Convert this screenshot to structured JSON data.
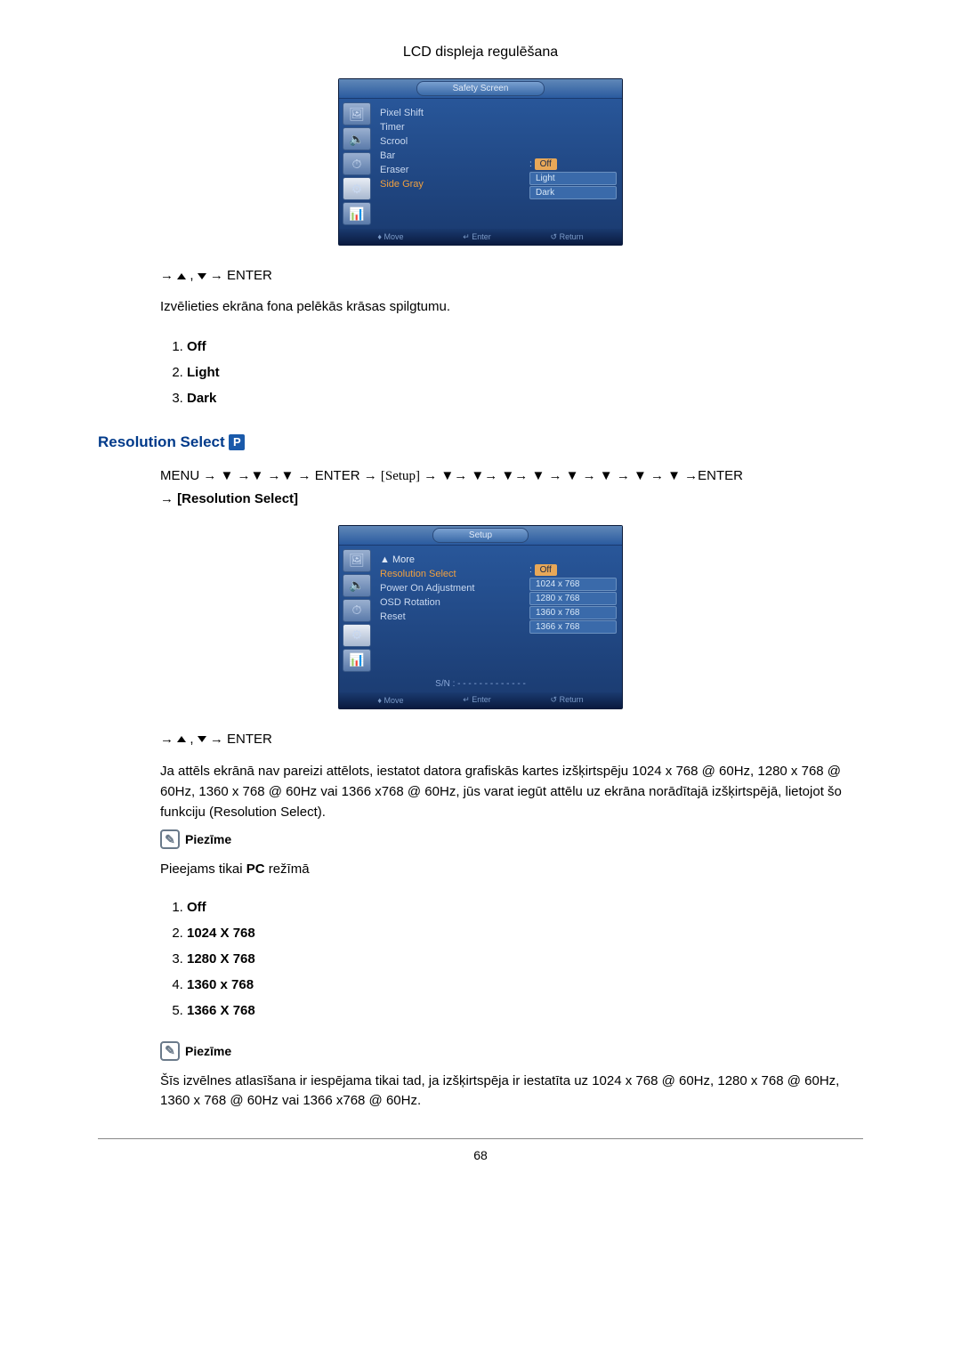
{
  "header": {
    "title": "LCD displeja regulēšana"
  },
  "osd1": {
    "title": "Safety Screen",
    "items": [
      "Pixel Shift",
      "Timer",
      "Scrool",
      "Bar",
      "Eraser",
      "Side Gray"
    ],
    "sel_idx": 5,
    "values": [
      "Off",
      "Light",
      "Dark"
    ],
    "val_sel_idx": 0,
    "bottom": {
      "move": "Move",
      "enter": "Enter",
      "return": "Return"
    }
  },
  "nav1": "→ ▲ , ▼ → ENTER",
  "desc1": "Izvēlieties ekrāna fona pelēkās krāsas spilgtumu.",
  "opts1": [
    "Off",
    "Light",
    "Dark"
  ],
  "section2": {
    "title": "Resolution Select"
  },
  "nav2a_prefix": "MENU → ▼ →▼ →▼ → ENTER → ",
  "nav2a_setup": "[Setup]",
  "nav2a_mid": " → ▼→ ▼→ ▼→ ▼ → ▼ → ▼ → ▼ → ▼ →ENTER",
  "nav2b": "→ ",
  "nav2b_bold": "[Resolution Select]",
  "osd2": {
    "title": "Setup",
    "more": "▲ More",
    "items": [
      "Resolution Select",
      "Power On Adjustment",
      "OSD Rotation",
      "Reset"
    ],
    "sel_idx": 0,
    "values": [
      "Off",
      "1024 x 768",
      "1280 x 768",
      "1360 x 768",
      "1366 x 768"
    ],
    "val_sel_idx": 0,
    "sn": "S/N : - - - - - - - - - - - - -",
    "bottom": {
      "move": "Move",
      "enter": "Enter",
      "return": "Return"
    }
  },
  "nav3": "→ ▲ , ▼ → ENTER",
  "desc2": "Ja attēls ekrānā nav pareizi attēlots, iestatot datora grafiskās kartes izšķirtspēju 1024 x 768 @ 60Hz, 1280 x 768 @ 60Hz, 1360 x 768 @ 60Hz vai 1366 x768 @ 60Hz, jūs varat iegūt attēlu uz ekrāna norādītajā izšķirtspējā, lietojot šo funkciju (Resolution Select).",
  "note1_label": "Piezīme",
  "note1_text_a": "Pieejams tikai ",
  "note1_text_b": "PC",
  "note1_text_c": " režīmā",
  "opts2": [
    "Off",
    "1024 X 768",
    "1280 X 768",
    "1360 x 768",
    "1366 X 768"
  ],
  "note2_label": "Piezīme",
  "note2_text": "Šīs izvēlnes atlasīšana ir iespējama tikai tad, ja izšķirtspēja ir iestatīta uz 1024 x 768 @ 60Hz, 1280 x 768 @ 60Hz, 1360 x 768 @ 60Hz vai 1366 x768 @ 60Hz.",
  "pagenum": "68"
}
